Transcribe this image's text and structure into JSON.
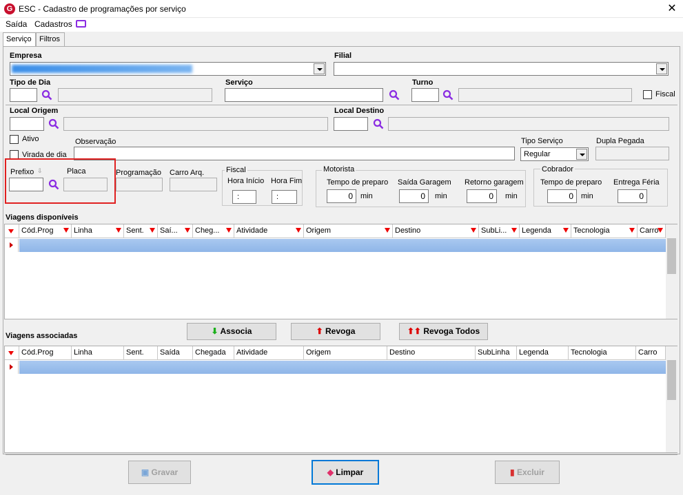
{
  "window": {
    "title": "ESC - Cadastro de programações por serviço",
    "app_icon": "G",
    "close": "✕"
  },
  "menu": {
    "saida": "Saída",
    "cadastros": "Cadastros"
  },
  "tabs": {
    "servico": "Serviço",
    "filtros": "Filtros"
  },
  "form": {
    "empresa": "Empresa",
    "filial": "Filial",
    "tipo_dia": "Tipo de Dia",
    "servico": "Serviço",
    "turno": "Turno",
    "fiscal": "Fiscal",
    "local_origem": "Local Origem",
    "local_destino": "Local Destino",
    "ativo": "Ativo",
    "virada_dia": "Virada de dia",
    "observacao": "Observação",
    "tipo_servico": "Tipo Serviço",
    "tipo_servico_value": "Regular",
    "dupla_pegada": "Dupla Pegada",
    "prefixo": "Prefixo",
    "placa": "Placa",
    "programacao": "Programação",
    "carro_arq": "Carro Arq.",
    "fiscal_group": "Fiscal",
    "hora_inicio": "Hora Início",
    "hora_fim": "Hora Fim",
    "hora_inicio_value": ":",
    "hora_fim_value": ":",
    "motorista": "Motorista",
    "tempo_preparo": "Tempo de preparo",
    "saida_garagem": "Saída Garagem",
    "retorno_garagem": "Retorno garagem",
    "mot_preparo": "0",
    "mot_saida": "0",
    "mot_retorno": "0",
    "min": "min",
    "cobrador": "Cobrador",
    "cob_tempo_preparo": "Tempo de preparo",
    "entrega_ferias": "Entrega Féria",
    "cob_preparo": "0",
    "cob_entrega": "0"
  },
  "grid1": {
    "title": "Viagens disponíveis",
    "columns": [
      "Cód.Prog",
      "Linha",
      "Sent.",
      "Saí...",
      "Cheg...",
      "Atividade",
      "Origem",
      "Destino",
      "SubLi...",
      "Legenda",
      "Tecnologia",
      "Carro"
    ]
  },
  "grid2": {
    "title": "Viagens associadas",
    "columns": [
      "Cód.Prog",
      "Linha",
      "Sent.",
      "Saída",
      "Chegada",
      "Atividade",
      "Origem",
      "Destino",
      "SubLinha",
      "Legenda",
      "Tecnologia",
      "Carro"
    ]
  },
  "buttons": {
    "associa": "Associa",
    "revoga": "Revoga",
    "revoga_todos": "Revoga Todos",
    "gravar": "Gravar",
    "limpar": "Limpar",
    "excluir": "Excluir"
  },
  "colors": {
    "highlight": "#e02020",
    "row_select": "#9fc0ec",
    "search_icon": "#8a2be2"
  }
}
